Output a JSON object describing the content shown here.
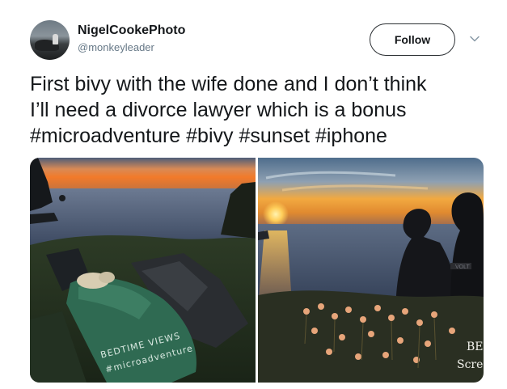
{
  "user": {
    "name": "NigelCookePhoto",
    "handle": "@monkeyleader"
  },
  "actions": {
    "follow_label": "Follow",
    "menu_icon": "chevron-down-icon"
  },
  "tweet": {
    "lines": [
      "First bivy with the wife done and I don’t think",
      "I’ll need a divorce lawyer which is a bonus",
      "#microadventure #bivy #sunset #iphone"
    ]
  },
  "media": {
    "photo_1": {
      "bag_text_line_1": "BEDTIME VIEWS",
      "bag_text_line_2": "#microadventure"
    },
    "photo_2": {
      "edge_text_1": "BE",
      "edge_text_2": "Scree",
      "jacket_text": "VOLT"
    }
  },
  "colors": {
    "text": "#14171a",
    "secondary_text": "#657786",
    "button_border": "#2b2f33"
  }
}
